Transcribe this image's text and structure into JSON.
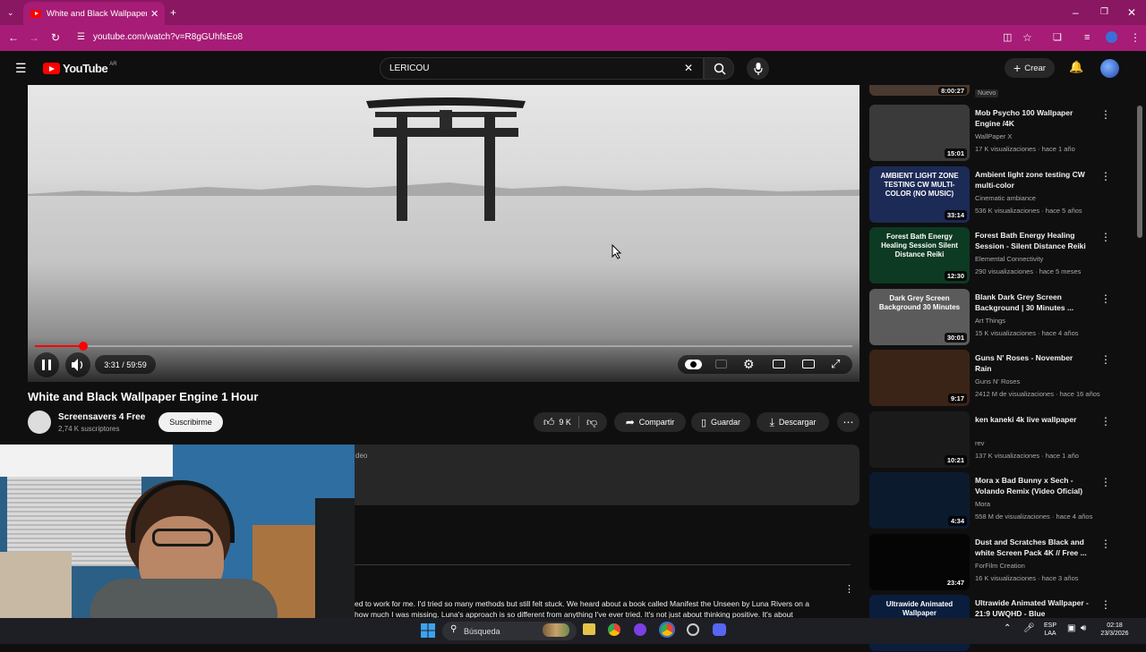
{
  "browser": {
    "tab_title": "White and Black Wallpaper Engi",
    "url": "youtube.com/watch?v=R8gGUhfsEo8"
  },
  "youtube": {
    "logo_text": "YouTube",
    "region": "AR",
    "search_value": "LERICOU",
    "create_label": "Crear"
  },
  "player": {
    "time": "3:31 / 59:59",
    "progress": 0.0587
  },
  "video": {
    "title": "White and Black Wallpaper Engine 1 Hour",
    "channel": "Screensavers 4 Free",
    "subscribers": "2,74 K suscriptores",
    "subscribe_label": "Suscribirme",
    "likes": "9 K",
    "share_label": "Compartir",
    "save_label": "Guardar",
    "download_label": "Descargar",
    "description_fragment": "deo"
  },
  "comment": {
    "line1": "ed to work for me. I'd tried so many methods but still felt stuck. We heard about a book called Manifest the Unseen by Luna Rivers on a",
    "line2": "how much I was missing. Luna's approach is so different from anything I've ever tried. It's not just about thinking positive. It's about"
  },
  "sidebar": {
    "top_duration": "8:00:27",
    "top_badge": "Nuevo",
    "items": [
      {
        "title": "Mob Psycho 100 Wallpaper Engine /4K",
        "channel": "WallPaper X",
        "views": "17 K visualizaciones · hace 1 año",
        "duration": "15:01",
        "color": "#3a3a3a"
      },
      {
        "title": "Ambient light zone testing CW multi-color",
        "channel": "Cinematic ambiance",
        "views": "536 K visualizaciones · hace 5 años",
        "duration": "33:14",
        "color": "#1c2a56",
        "thumb_text": "AMBIENT LIGHT ZONE TESTING CW MULTI-COLOR (NO MUSIC)"
      },
      {
        "title": "Forest Bath Energy Healing Session - Silent Distance Reiki",
        "channel": "Elemental Connectivity",
        "views": "290 visualizaciones · hace 5 meses",
        "duration": "12:30",
        "color": "#0d3a22",
        "thumb_text": "Forest Bath Energy Healing Session Silent Distance Reiki"
      },
      {
        "title": "Blank Dark Grey Screen Background | 30 Minutes ...",
        "channel": "Art Things",
        "views": "15 K visualizaciones · hace 4 años",
        "duration": "30:01",
        "color": "#5b5b5b",
        "thumb_text": "Dark Grey Screen Background 30 Minutes"
      },
      {
        "title": "Guns N' Roses - November Rain",
        "channel": "Guns N' Roses",
        "views": "2412 M de visualizaciones · hace 16 años",
        "duration": "9:17",
        "color": "#3a2418"
      },
      {
        "title": "ken kaneki 4k live wallpaper",
        "channel": "rev",
        "views": "137 K visualizaciones · hace 1 año",
        "duration": "10:21",
        "color": "#1a1a1a"
      },
      {
        "title": "Mora x Bad Bunny x Sech - Volando Remix (Video Oficial)",
        "channel": "Mora",
        "views": "558 M de visualizaciones · hace 4 años",
        "duration": "4:34",
        "color": "#0c1a2e"
      },
      {
        "title": "Dust and Scratches Black and white Screen Pack 4K // Free ...",
        "channel": "ForFilm Creation",
        "views": "16 K visualizaciones · hace 3 años",
        "duration": "23:47",
        "color": "#050505"
      },
      {
        "title": "Ultrawide Animated Wallpaper - 21:9 UWQHD - Blue",
        "channel": "",
        "views": "",
        "duration": "",
        "color": "#0a1d3d",
        "thumb_text": "Ultrawide Animated Wallpaper"
      }
    ]
  },
  "taskbar": {
    "search_label": "Búsqueda",
    "lang1": "ESP",
    "lang2": "LAA",
    "time": "02:18",
    "date": "23/3/2026"
  }
}
